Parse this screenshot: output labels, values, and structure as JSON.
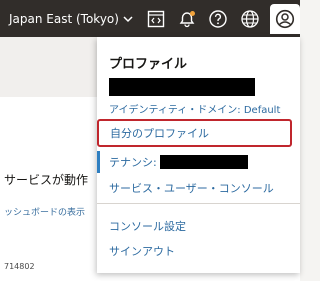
{
  "header": {
    "region_label": "Japan East (Tokyo)",
    "icons": [
      "chevron-down-icon",
      "code-editor-icon",
      "notification-bell-icon",
      "help-icon",
      "globe-language-icon",
      "profile-avatar-icon"
    ],
    "bg_color": "#312d2a"
  },
  "background_page": {
    "line1": "サービスが動作",
    "line2": "ッシュボードの表示",
    "line3": "714802"
  },
  "profile_menu": {
    "title": "プロファイル",
    "domain_label": "アイデンティティ・ドメイン: Default",
    "my_profile": "自分のプロファイル",
    "tenancy_label": "テナンシ:",
    "service_user_console": "サービス・ユーザー・コンソール",
    "console_settings": "コンソール設定",
    "sign_out": "サインアウト",
    "highlight_color": "#c0262d",
    "link_color": "#2c6aa0"
  }
}
